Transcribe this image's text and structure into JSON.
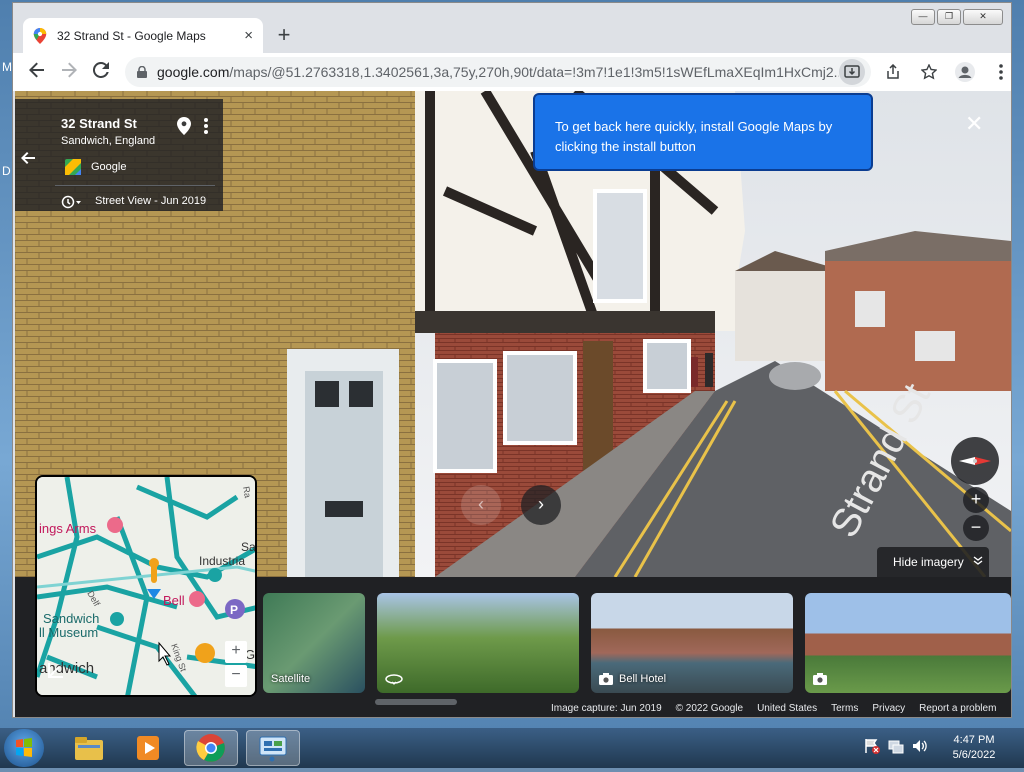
{
  "desktop": {
    "side_letters": [
      "M",
      "D"
    ]
  },
  "browser": {
    "tab": {
      "title": "32 Strand St - Google Maps",
      "close_glyph": "×"
    },
    "new_tab_glyph": "+",
    "window_controls": {
      "minimize": "—",
      "maximize": "❐",
      "close": "✕"
    },
    "url": {
      "domain": "google.com",
      "rest": "/maps/@51.2763318,1.3402561,3a,75y,270h,90t/data=!3m7!1e1!3m5!1sWEfLmaXEqIm1HxCmj2..."
    },
    "icons": [
      "back-icon",
      "forward-icon",
      "reload-icon",
      "lock-icon",
      "install-icon",
      "share-icon",
      "bookmark-star-icon",
      "profile-icon",
      "menu-icon"
    ]
  },
  "maps": {
    "info_card": {
      "title": "32 Strand St",
      "subtitle": "Sandwich, England",
      "source": "Google",
      "street_view_date": "Street View - Jun 2019"
    },
    "install_bubble": {
      "text": "To get back here quickly, install Google Maps by clicking the install button",
      "close_glyph": "✕"
    },
    "controls": {
      "zoom_in": "+",
      "zoom_out": "−",
      "hide_imagery": "Hide imagery",
      "next_arrow": "›",
      "prev_arrow": "‹"
    },
    "minimap": {
      "labels": [
        "ings Arms",
        "Industria",
        "Sa",
        "Bell",
        "Sandwich",
        "ll Museum",
        "andwich",
        "Delf",
        "Ra",
        "King St",
        "G"
      ],
      "zoom_in": "+",
      "zoom_out": "−"
    },
    "thumbnails": [
      {
        "label": "Satellite"
      },
      {
        "label": ""
      },
      {
        "label": "Bell Hotel"
      },
      {
        "label": ""
      }
    ],
    "footer": {
      "capture": "Image capture: Jun 2019",
      "copyright": "© 2022 Google",
      "country": "United States",
      "terms": "Terms",
      "privacy": "Privacy",
      "report": "Report a problem"
    }
  },
  "taskbar": {
    "time": "4:47 PM",
    "date": "5/6/2022",
    "apps": [
      "start-orb",
      "file-explorer",
      "media-player",
      "chrome",
      "control-panel"
    ]
  },
  "colors": {
    "bubble_blue": "#1a73e8",
    "chrome_frame": "#dee1e6",
    "maps_dark": "#202124"
  }
}
